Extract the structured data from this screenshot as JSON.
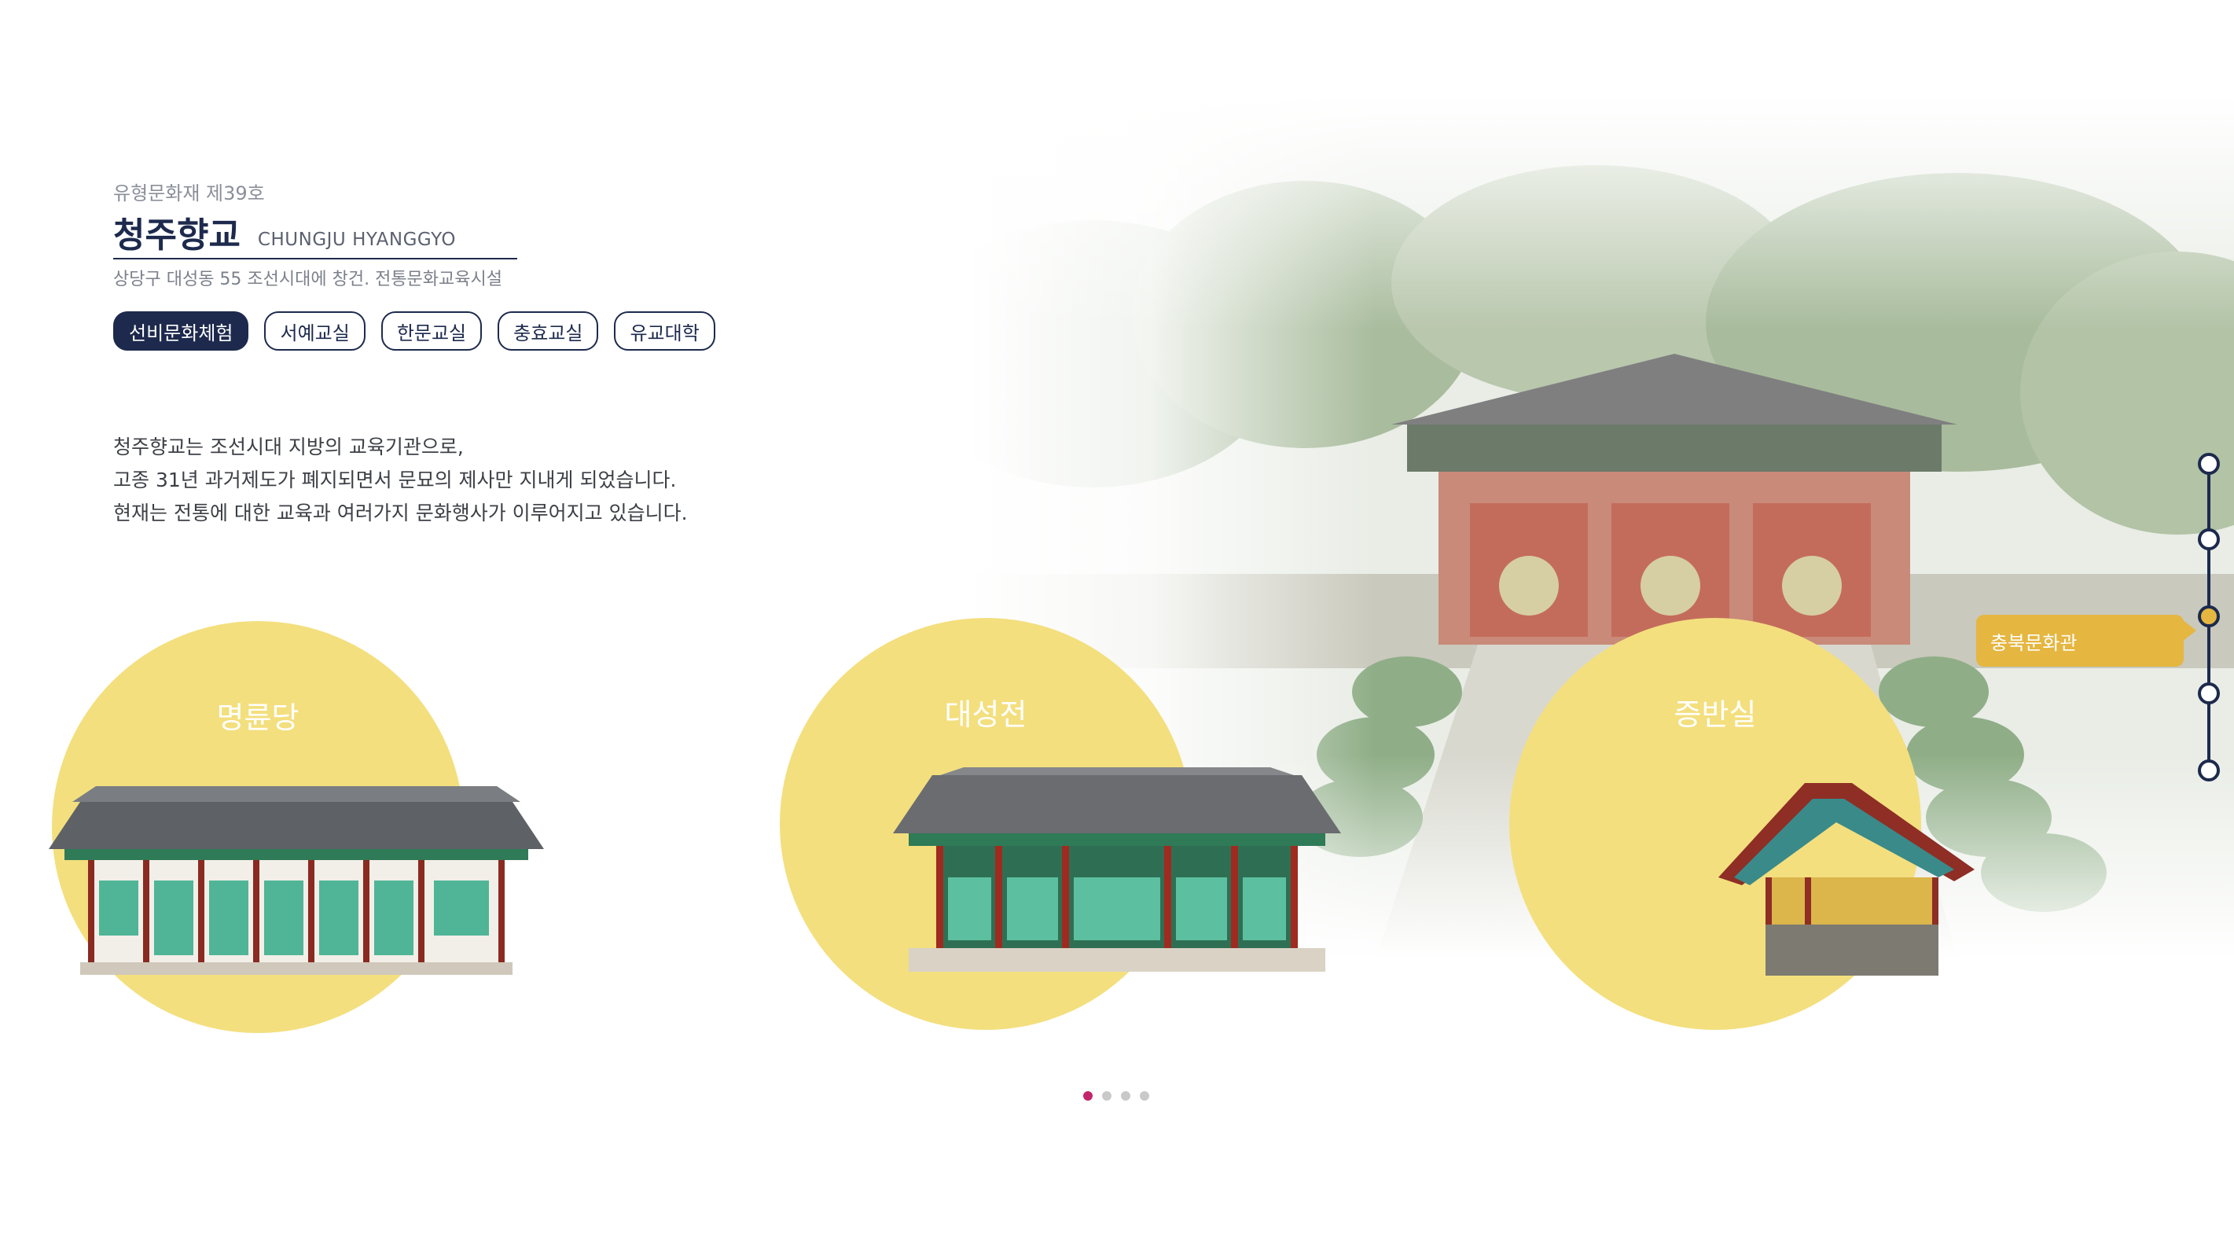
{
  "header": {
    "heritage_no": "유형문화재 제39호",
    "title_ko": "청주향교",
    "title_en": "CHUNGJU HYANGGYO",
    "subtitle": "상당구 대성동 55 조선시대에 창건. 전통문화교육시설"
  },
  "tabs": [
    {
      "label": "선비문화체험",
      "active": true
    },
    {
      "label": "서예교실",
      "active": false
    },
    {
      "label": "한문교실",
      "active": false
    },
    {
      "label": "충효교실",
      "active": false
    },
    {
      "label": "유교대학",
      "active": false
    }
  ],
  "description": [
    "청주향교는 조선시대 지방의 교육기관으로,",
    "고종 31년 과거제도가 폐지되면서 문묘의 제사만 지내게 되었습니다.",
    "현재는 전통에 대한 교육과 여러가지 문화행사가 이루어지고 있습니다."
  ],
  "buildings": [
    {
      "name": "명륜당"
    },
    {
      "name": "대성전"
    },
    {
      "name": "증반실"
    }
  ],
  "pager": {
    "pages": 4,
    "active_index": 0
  },
  "side_nav": {
    "nodes": 5,
    "active_index": 2,
    "tooltip": "충북문화관"
  },
  "colors": {
    "navy": "#1d2a4d",
    "circle_yellow": "#f3df7e",
    "accent_yellow": "#e5b640",
    "pager_active": "#c2256b"
  }
}
